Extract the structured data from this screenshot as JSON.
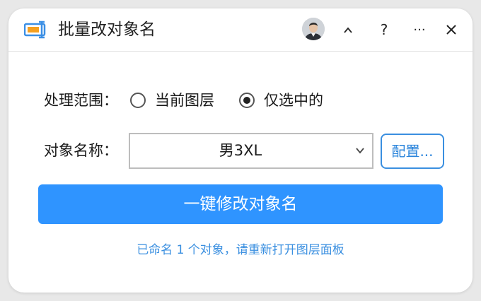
{
  "window": {
    "title": "批量改对象名",
    "controls": {
      "collapse": "^",
      "help": "?",
      "more": "···",
      "close": "✕"
    }
  },
  "scope": {
    "label": "处理范围：",
    "options": [
      {
        "label": "当前图层",
        "selected": false
      },
      {
        "label": "仅选中的",
        "selected": true
      }
    ]
  },
  "object_name": {
    "label": "对象名称：",
    "selected_value": "男3XL",
    "config_label": "配置..."
  },
  "action_button": "一键修改对象名",
  "status_message": "已命名 1 个对象，请重新打开图层面板",
  "colors": {
    "accent": "#2f94ff",
    "link": "#3a8fe0",
    "icon_orange": "#f5a020",
    "icon_blue": "#3b8fe5"
  }
}
